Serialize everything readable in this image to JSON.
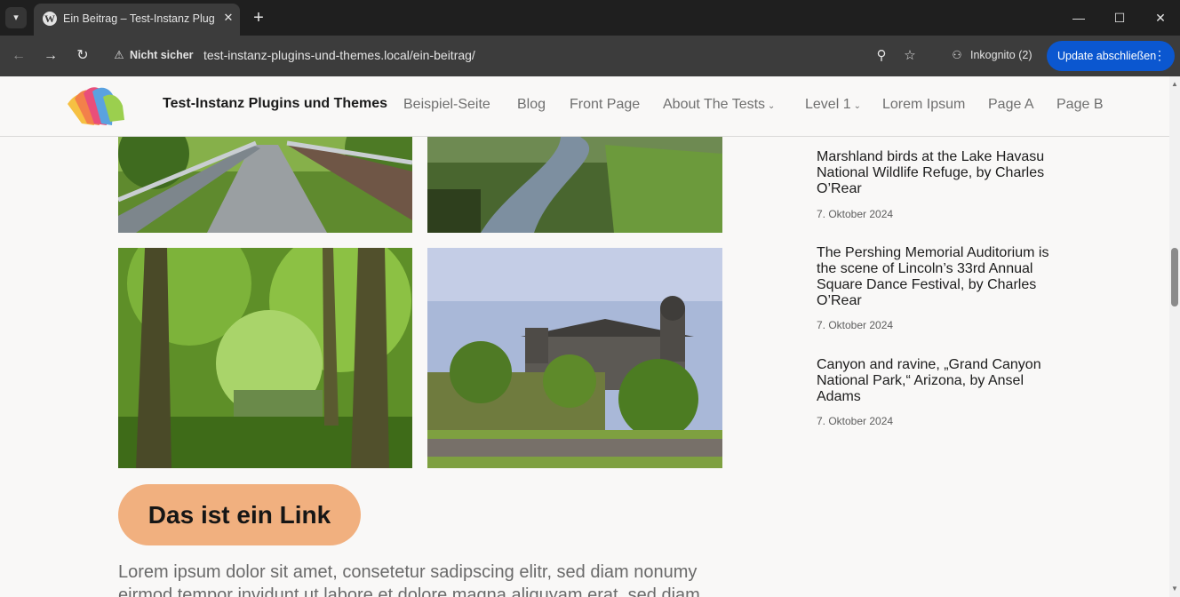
{
  "browser": {
    "tab_title": "Ein Beitrag – Test-Instanz Plugins und Themes",
    "address_security": "Nicht sicher",
    "url": "test-instanz-plugins-und-themes.local/ein-beitrag/",
    "incognito_label": "Inkognito (2)",
    "update_label": "Update abschließen",
    "icons": {
      "tab_search": "chevron-down-icon",
      "favicon": "wordpress-icon",
      "close": "close-icon",
      "new_tab": "plus-icon",
      "back": "arrow-left-icon",
      "forward": "arrow-right-icon",
      "reload": "reload-icon",
      "warning": "warning-icon",
      "zoom": "zoom-icon",
      "bookmark": "star-icon",
      "incognito": "incognito-icon",
      "menu": "kebab-icon"
    }
  },
  "site": {
    "title": "Test-Instanz Plugins und Themes",
    "menu": [
      {
        "label": "Beispiel-Seite",
        "has_submenu": false
      },
      {
        "label": "Blog",
        "has_submenu": false
      },
      {
        "label": "Front Page",
        "has_submenu": false
      },
      {
        "label": "About The Tests",
        "has_submenu": true
      },
      {
        "label": "Level 1",
        "has_submenu": true
      },
      {
        "label": "Lorem Ipsum",
        "has_submenu": false
      },
      {
        "label": "Page A",
        "has_submenu": false
      },
      {
        "label": "Page B",
        "has_submenu": false
      }
    ]
  },
  "content": {
    "link_button": "Das ist ein Link",
    "paragraph": "Lorem ipsum dolor sit amet, consetetur sadipscing elitr, sed diam nonumy eirmod tempor invidunt ut labore et dolore magna aliquyam erat, sed diam"
  },
  "sidebar": {
    "recent_posts": [
      {
        "title": "Marshland birds at the Lake Havasu National Wildlife Refuge, by Charles O’Rear",
        "date": "7. Oktober 2024"
      },
      {
        "title": "The Pershing Memorial Auditorium is the scene of Lincoln’s 33rd Annual Square Dance Festival, by Charles O’Rear",
        "date": "7. Oktober 2024"
      },
      {
        "title": "Canyon and ravine, „Grand Canyon National Park,“ Arizona, by Ansel Adams",
        "date": "7. Oktober 2024"
      }
    ]
  },
  "colors": {
    "chrome_dark": "#1f1f1f",
    "toolbar": "#3c3c3c",
    "update_blue": "#0b57d0",
    "link_button": "#f1b07f",
    "page_bg": "#f9f8f7"
  }
}
